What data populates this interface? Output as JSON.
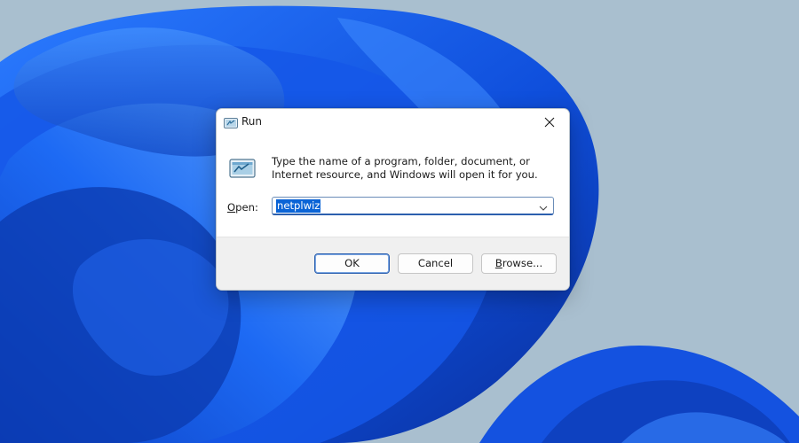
{
  "dialog": {
    "title": "Run",
    "description": "Type the name of a program, folder, document, or Internet resource, and Windows will open it for you.",
    "open_label_mnemonic": "O",
    "open_label_rest": "pen:",
    "open_value": "netplwiz",
    "buttons": {
      "ok": "OK",
      "cancel": "Cancel",
      "browse_mnemonic": "B",
      "browse_rest": "rowse..."
    }
  },
  "icons": {
    "title": "run-icon",
    "dialog": "run-icon",
    "close": "close-icon",
    "dropdown": "chevron-down-icon"
  },
  "colors": {
    "accent": "#0a64d6",
    "wallpaper_blue": "#1a5ee6",
    "wallpaper_background": "#a7bccd"
  }
}
